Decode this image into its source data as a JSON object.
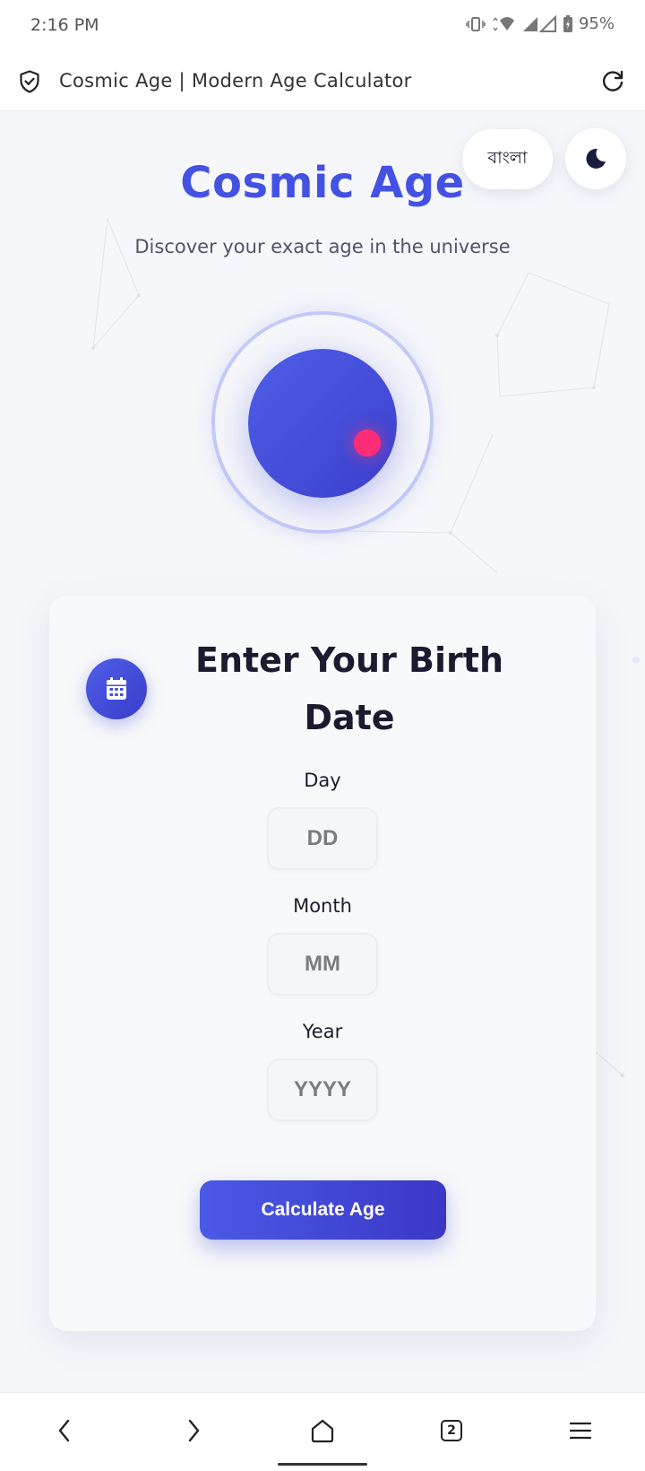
{
  "status_bar": {
    "time": "2:16 PM",
    "battery": "95%"
  },
  "browser": {
    "page_title": "Cosmic Age | Modern Age Calculator",
    "tab_count": "2"
  },
  "header": {
    "language_label": "বাংলা",
    "title": "Cosmic Age",
    "subtitle": "Discover your exact age in the universe"
  },
  "card": {
    "title": "Enter Your Birth Date",
    "day_label": "Day",
    "day_placeholder": "DD",
    "month_label": "Month",
    "month_placeholder": "MM",
    "year_label": "Year",
    "year_placeholder": "YYYY",
    "submit_label": "Calculate Age"
  },
  "colors": {
    "accent": "#4452e4",
    "moon": "#ff2d78"
  },
  "icons": [
    "vibrate-icon",
    "wifi-icon",
    "signal-icon",
    "battery-icon",
    "shield-check-icon",
    "reload-icon",
    "moon-icon",
    "calendar-icon",
    "back-icon",
    "forward-icon",
    "home-icon",
    "tabs-icon",
    "menu-icon"
  ]
}
